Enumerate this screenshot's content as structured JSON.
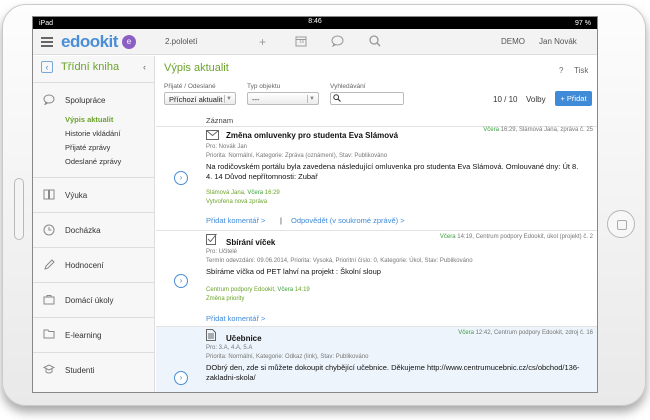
{
  "status": {
    "carrier": "iPad",
    "time": "8:46",
    "battery": "97 %"
  },
  "topnav": {
    "logo": "edookit",
    "logo_badge": "e",
    "semester": "2.pololetí",
    "calendar_day": "15",
    "demo": "DEMO",
    "user": "Jan Novák"
  },
  "sidebar": {
    "title": "Třídní kniha",
    "back_icon": "‹",
    "collapse_icon": "‹",
    "groups": [
      {
        "label": "Spolupráce",
        "icon": "chat-icon"
      },
      {
        "label": "Výuka",
        "icon": "book-icon"
      },
      {
        "label": "Docházka",
        "icon": "clock-icon"
      },
      {
        "label": "Hodnocení",
        "icon": "pencil-icon"
      },
      {
        "label": "Domácí úkoly",
        "icon": "briefcase-icon"
      },
      {
        "label": "E-learning",
        "icon": "folder-icon"
      },
      {
        "label": "Studenti",
        "icon": "graduate-icon"
      }
    ],
    "subitems": [
      "Výpis aktualit",
      "Historie vkládání",
      "Přijaté zprávy",
      "Odeslané zprávy"
    ]
  },
  "main": {
    "title": "Výpis aktualit",
    "help": "?",
    "print": "Tisk",
    "filters": {
      "received_sent_label": "Přijaté / Odeslané",
      "received_sent_value": "Příchozí aktualit",
      "object_type_label": "Typ objektu",
      "object_type_value": "---",
      "search_label": "Vyhledávání",
      "search_value": ""
    },
    "count": "10 / 10",
    "options": "Volby",
    "add_button": "+ Přidat",
    "column_header": "Záznam"
  },
  "records": [
    {
      "icon": "envelope-icon",
      "title": "Změna omluvenky pro studenta Eva Slámová",
      "meta_date": "Včera",
      "meta_rest": "16:29, Slámová Jana, zpráva č. 25",
      "line1": "Pro: Novák Jan",
      "line2": "Priorita: Normální, Kategorie: Zpráva (oznámení), Stav: Publikováno",
      "body": "Na rodičovském portálu byla zavedena následující omluvenka pro studenta Eva Slámová. Omlouvané dny: Út 8. 4. 14 Důvod nepřítomnosti: Zubař",
      "author_name": "Slámová Jana,",
      "author_date": "Včera",
      "author_time": "16:29",
      "created": "Vytvořena nová zpráva",
      "link_comment": "Přidat komentář >",
      "separator": "|",
      "link_reply": "Odpovědět (v soukromé zprávě) >"
    },
    {
      "icon": "checkbox-icon",
      "title": "Sbírání víček",
      "meta_date": "Včera",
      "meta_rest": "14:19, Centrum podpory Edookit, úkol (projekt) č. 2",
      "line1": "Pro: Učitelé",
      "line2": "Termín odevzdání: 09.06.2014, Priorita: Vysoká, Prioritní číslo: 0, Kategorie: Úkol, Stav: Publikováno",
      "body": "Sbíráme víčka od PET lahví na projekt : Školní sloup",
      "author_name": "Centrum podpory Edookit,",
      "author_date": "Včera",
      "author_time": "14:19",
      "created": "Změna priority",
      "link_comment": "Přidat komentář >"
    },
    {
      "icon": "document-icon",
      "title": "Učebnice",
      "meta_date": "Včera",
      "meta_rest": "12:42, Centrum podpory Edookit, zdroj č. 16",
      "line1": "Pro: 3.A, 4.A, 5.A",
      "line2": "Priorita: Normální, Kategorie: Odkaz (link), Stav: Publikováno",
      "body": "DObrý den, zde si můžete dokoupit chybějící učebnice. Děkujeme http://www.centrumucebnic.cz/cs/obchod/136-zakladni-skola/"
    }
  ]
}
